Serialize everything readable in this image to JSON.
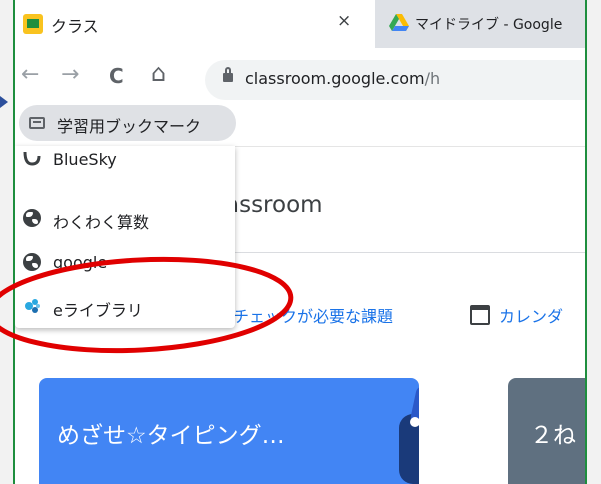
{
  "tabs": [
    {
      "title": "クラス",
      "close": "×",
      "icon": "classroom-icon",
      "active": true
    },
    {
      "title": "マイドライブ - Google",
      "icon": "google-drive-icon",
      "active": false
    }
  ],
  "toolbar": {
    "back": "←",
    "forward": "→",
    "reload": "C",
    "home": "⌂"
  },
  "omnibox": {
    "host": "classroom.google.com",
    "path": "/h"
  },
  "bookmarks": {
    "folder_label": "学習用ブックマーク",
    "folder_icon": "folder-icon"
  },
  "menu": {
    "items": [
      {
        "label": "BlueSky",
        "icon": "bluesky-icon"
      },
      {
        "label": "わくわく算数",
        "icon": "globe-icon"
      },
      {
        "label": "google",
        "icon": "globe-icon"
      },
      {
        "label": "eライブラリ",
        "icon": "elibrary-icon"
      }
    ]
  },
  "page": {
    "title": "assroom",
    "check_tasks": "チェックが必要な課題",
    "calendar": "カレンダ",
    "cards": [
      {
        "title": "めざせ☆タイピング…",
        "color": "#4285f4"
      },
      {
        "title": "２ね",
        "color": "#5f7080"
      }
    ]
  },
  "colors": {
    "frame": "#1e8e3e",
    "link": "#1a73e8",
    "highlight": "#e00000"
  }
}
